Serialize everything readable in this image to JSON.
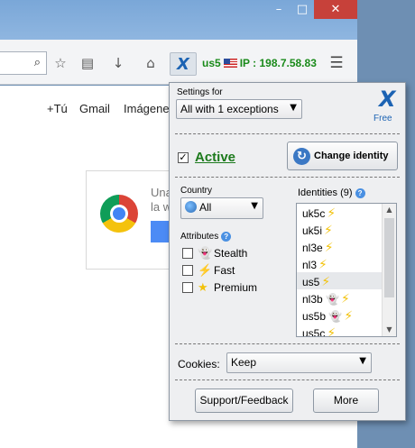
{
  "window": {
    "minimize": "–",
    "maximize": "□",
    "close": "✕"
  },
  "toolbar": {
    "search_icon": "search-icon",
    "extension_logo": "X",
    "extension_status": {
      "location_code": "us5",
      "ip_text": "IP : 198.7.58.83"
    }
  },
  "page": {
    "links": [
      "+Tú",
      "Gmail",
      "Imágene"
    ],
    "promo_text": [
      "Una",
      "la w"
    ]
  },
  "panel": {
    "settings_label": "Settings for",
    "settings_value": "All with 1 exceptions",
    "logo_text": "X",
    "logo_subtitle": "Free",
    "active_label": "Active",
    "change_identity_label": "Change identity",
    "country_label": "Country",
    "country_value": "All",
    "attributes_label": "Attributes",
    "attributes": [
      {
        "label": "Stealth",
        "icon": "ghost-icon",
        "checked": false
      },
      {
        "label": "Fast",
        "icon": "bolt-icon",
        "checked": false
      },
      {
        "label": "Premium",
        "icon": "star-icon",
        "checked": false
      }
    ],
    "identities_label": "Identities (9)",
    "identities": [
      {
        "name": "uk5c",
        "icons": [
          "bolt-icon"
        ]
      },
      {
        "name": "uk5i",
        "icons": [
          "bolt-icon"
        ]
      },
      {
        "name": "nl3e",
        "icons": [
          "bolt-icon"
        ]
      },
      {
        "name": "nl3",
        "icons": [
          "bolt-icon"
        ]
      },
      {
        "name": "us5",
        "icons": [
          "bolt-icon"
        ],
        "selected": true
      },
      {
        "name": "nl3b",
        "icons": [
          "ghost-icon",
          "bolt-icon"
        ]
      },
      {
        "name": "us5b",
        "icons": [
          "ghost-icon",
          "bolt-icon"
        ]
      },
      {
        "name": "us5c",
        "icons": [
          "bolt-icon"
        ]
      }
    ],
    "cookies_label": "Cookies:",
    "cookies_value": "Keep",
    "support_label": "Support/Feedback",
    "more_label": "More"
  },
  "colors": {
    "accent": "#1c63b3",
    "active_green": "#1c7a1c",
    "status_green": "#1a8a1a",
    "bolt": "#f2c20b",
    "close_red": "#c7413a"
  }
}
